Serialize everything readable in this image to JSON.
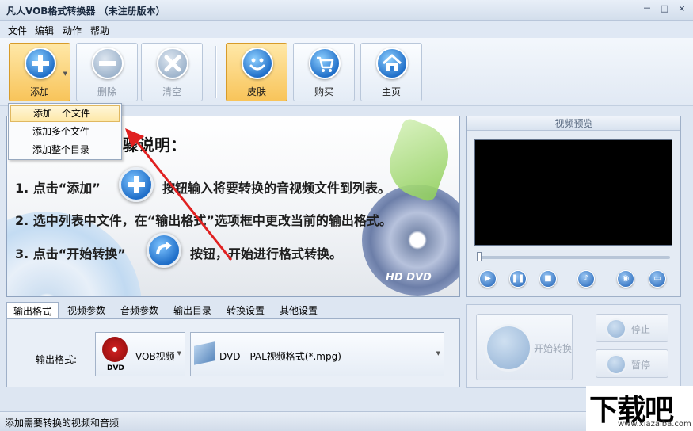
{
  "window": {
    "title": "凡人VOB格式转换器 （未注册版本）",
    "buttons": {
      "minimize": "－",
      "maximize": "□",
      "close": "×"
    }
  },
  "menu": [
    "文件",
    "编辑",
    "动作",
    "帮助"
  ],
  "toolbar": {
    "add": "添加",
    "delete": "删除",
    "clear": "清空",
    "skin": "皮肤",
    "buy": "购买",
    "home": "主页"
  },
  "add_menu": [
    "添加一个文件",
    "添加多个文件",
    "添加整个目录"
  ],
  "guide": {
    "heading": "骤说明：",
    "step1a": "1. 点击“添加”",
    "step1b": "按钮输入将要转换的音视频文件到列表。",
    "step2": "2. 选中列表中文件，在“输出格式”选项框中更改当前的输出格式。",
    "step3a": "3. 点击“开始转换”",
    "step3b": "按钮，开始进行格式转换。",
    "disc_label": "HD DVD"
  },
  "preview": {
    "title": "视频预览",
    "progress": 0
  },
  "tabs": [
    "输出格式",
    "视频参数",
    "音频参数",
    "输出目录",
    "转换设置",
    "其他设置"
  ],
  "output": {
    "label": "输出格式:",
    "category": "VOB视频",
    "category_icon_text": "DVD",
    "format": "DVD - PAL视频格式(*.mpg)"
  },
  "actions": {
    "start": "开始转换",
    "stop": "停止",
    "pause": "暂停"
  },
  "status": "添加需要转换的视频和音频",
  "watermark": {
    "big": "下载吧",
    "small": "www.xiazaiba.com"
  },
  "colors": {
    "accent": "#f8c45a",
    "icon_blue": "#1f6ec8",
    "annotation_arrow": "#e02020"
  }
}
